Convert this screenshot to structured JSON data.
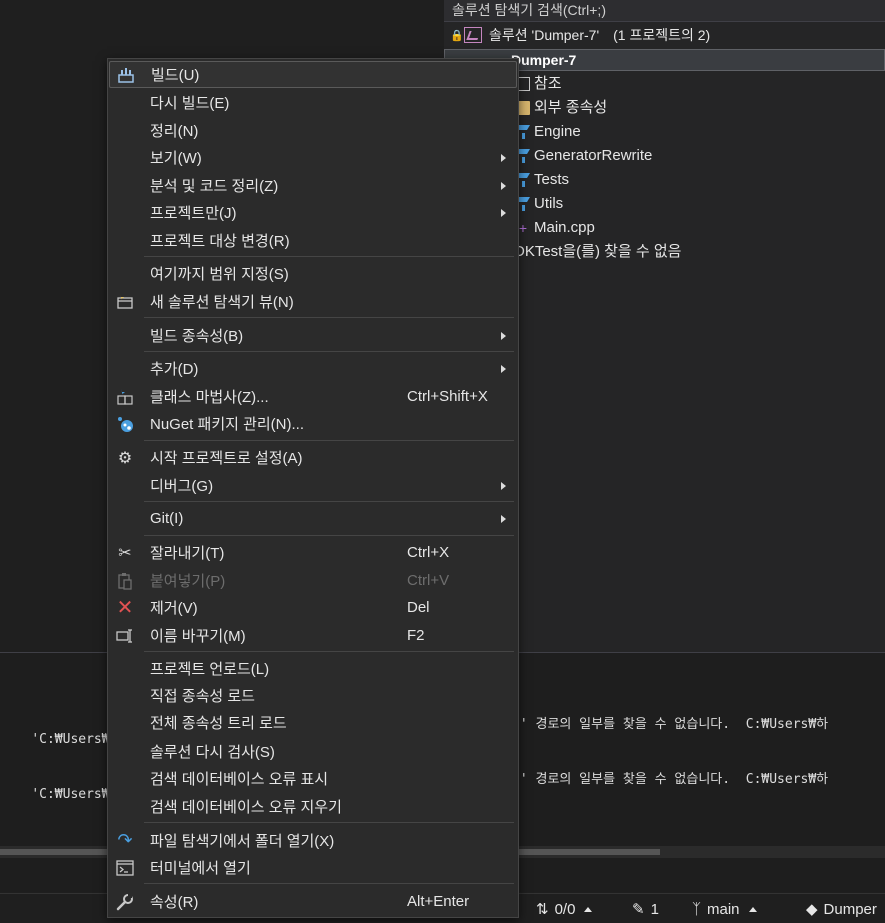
{
  "solution_explorer": {
    "search_placeholder": "솔루션 탐색기 검색(Ctrl+;)",
    "solution_label": "솔루션 'Dumper-7'",
    "solution_count": "(1 프로젝트의 2)",
    "project_name": "Dumper-7",
    "items": [
      {
        "label": "참조",
        "icon": "reference-icon"
      },
      {
        "label": "외부 종속성",
        "icon": "folder-icon"
      },
      {
        "label": "Engine",
        "icon": "filter-icon"
      },
      {
        "label": "GeneratorRewrite",
        "icon": "filter-icon"
      },
      {
        "label": "Tests",
        "icon": "filter-icon"
      },
      {
        "label": "Utils",
        "icon": "filter-icon"
      },
      {
        "label": "Main.cpp",
        "icon": "cpp-file-icon"
      },
      {
        "label": "DKTest을(를) 찾을 수 없음",
        "icon": "none"
      }
    ]
  },
  "output": {
    "lines": [
      {
        "left": "'C:₩Users₩하E",
        "right": "j' 경로의 일부를 찾을 수 없습니다.  C:₩Users₩하"
      },
      {
        "left": "'C:₩Users₩하E",
        "right": "j' 경로의 일부를 찾을 수 없습니다.  C:₩Users₩하"
      }
    ]
  },
  "statusbar": {
    "sync": "0/0",
    "pending_edits": "1",
    "branch": "main",
    "repo": "Dumper"
  },
  "context_menu": {
    "items": [
      {
        "label": "빌드(U)",
        "shortcut": "",
        "submenu": false,
        "icon": "build-icon"
      },
      {
        "label": "다시 빌드(E)",
        "shortcut": "",
        "submenu": false,
        "icon": ""
      },
      {
        "label": "정리(N)",
        "shortcut": "",
        "submenu": false,
        "icon": ""
      },
      {
        "label": "보기(W)",
        "shortcut": "",
        "submenu": true,
        "icon": ""
      },
      {
        "label": "분석 및 코드 정리(Z)",
        "shortcut": "",
        "submenu": true,
        "icon": ""
      },
      {
        "label": "프로젝트만(J)",
        "shortcut": "",
        "submenu": true,
        "icon": ""
      },
      {
        "label": "프로젝트 대상 변경(R)",
        "shortcut": "",
        "submenu": false,
        "icon": ""
      },
      {
        "label": "여기까지 범위 지정(S)",
        "shortcut": "",
        "submenu": false,
        "icon": ""
      },
      {
        "label": "새 솔루션 탐색기 뷰(N)",
        "shortcut": "",
        "submenu": false,
        "icon": "new-view-icon"
      },
      {
        "label": "빌드 종속성(B)",
        "shortcut": "",
        "submenu": true,
        "icon": ""
      },
      {
        "label": "추가(D)",
        "shortcut": "",
        "submenu": true,
        "icon": ""
      },
      {
        "label": "클래스 마법사(Z)...",
        "shortcut": "Ctrl+Shift+X",
        "submenu": false,
        "icon": "class-wizard-icon"
      },
      {
        "label": "NuGet 패키지 관리(N)...",
        "shortcut": "",
        "submenu": false,
        "icon": "nuget-icon"
      },
      {
        "label": "시작 프로젝트로 설정(A)",
        "shortcut": "",
        "submenu": false,
        "icon": "gear-icon"
      },
      {
        "label": "디버그(G)",
        "shortcut": "",
        "submenu": true,
        "icon": ""
      },
      {
        "label": "Git(I)",
        "shortcut": "",
        "submenu": true,
        "icon": ""
      },
      {
        "label": "잘라내기(T)",
        "shortcut": "Ctrl+X",
        "submenu": false,
        "icon": "scissors-icon"
      },
      {
        "label": "붙여넣기(P)",
        "shortcut": "Ctrl+V",
        "submenu": false,
        "icon": "paste-icon",
        "disabled": true
      },
      {
        "label": "제거(V)",
        "shortcut": "Del",
        "submenu": false,
        "icon": "remove-icon"
      },
      {
        "label": "이름 바꾸기(M)",
        "shortcut": "F2",
        "submenu": false,
        "icon": "rename-icon"
      },
      {
        "label": "프로젝트 언로드(L)",
        "shortcut": "",
        "submenu": false,
        "icon": ""
      },
      {
        "label": "직접 종속성 로드",
        "shortcut": "",
        "submenu": false,
        "icon": ""
      },
      {
        "label": "전체 종속성 트리 로드",
        "shortcut": "",
        "submenu": false,
        "icon": ""
      },
      {
        "label": "솔루션 다시 검사(S)",
        "shortcut": "",
        "submenu": false,
        "icon": ""
      },
      {
        "label": "검색 데이터베이스 오류 표시",
        "shortcut": "",
        "submenu": false,
        "icon": ""
      },
      {
        "label": "검색 데이터베이스 오류 지우기",
        "shortcut": "",
        "submenu": false,
        "icon": ""
      },
      {
        "label": "파일 탐색기에서 폴더 열기(X)",
        "shortcut": "",
        "submenu": false,
        "icon": "open-folder-icon"
      },
      {
        "label": "터미널에서 열기",
        "shortcut": "",
        "submenu": false,
        "icon": "terminal-icon"
      },
      {
        "label": "속성(R)",
        "shortcut": "Alt+Enter",
        "submenu": false,
        "icon": "wrench-icon"
      }
    ]
  }
}
